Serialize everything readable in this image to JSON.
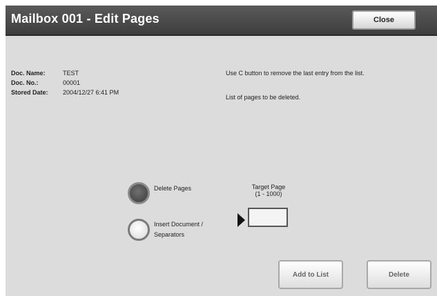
{
  "header": {
    "title": "Mailbox 001 - Edit Pages",
    "close_label": "Close"
  },
  "document": {
    "name_label": "Doc. Name:",
    "name_value": "TEST",
    "number_label": "Doc. No.:",
    "number_value": "00001",
    "date_label": "Stored Date:",
    "date_value": "2004/12/27 6:41 PM"
  },
  "messages": {
    "hint": "Use C button to remove the last entry from the list.",
    "list_title": "List of pages to be deleted."
  },
  "options": [
    {
      "label": "Delete Pages",
      "selected": true
    },
    {
      "label_line1": "Insert Document /",
      "label_line2": "Separators",
      "selected": false
    }
  ],
  "target": {
    "title": "Target Page",
    "range": "(1 - 1000)",
    "value": ""
  },
  "actions": {
    "add_label": "Add to List",
    "delete_label": "Delete"
  }
}
